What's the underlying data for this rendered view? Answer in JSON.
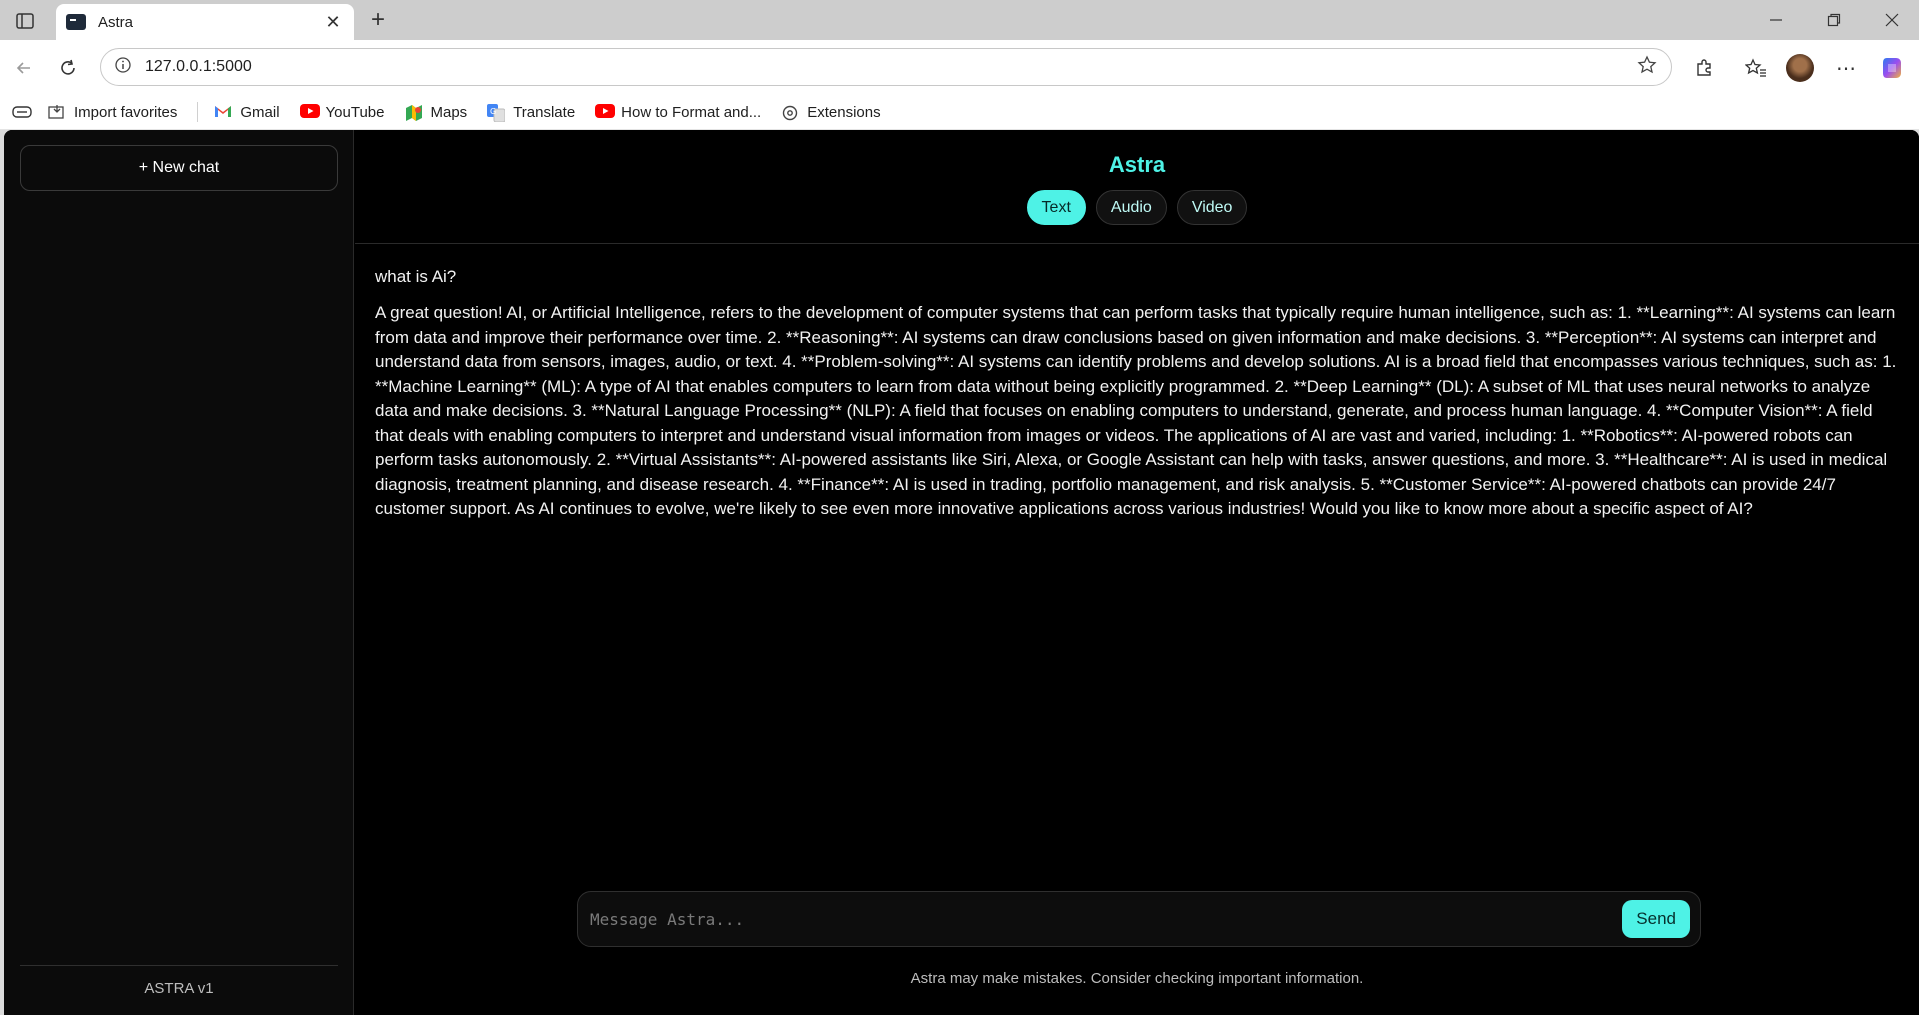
{
  "browser": {
    "tab_title": "Astra",
    "url": "127.0.0.1:5000",
    "bookmarks": [
      {
        "label": "Import favorites",
        "icon": "import-icon"
      },
      {
        "label": "Gmail",
        "icon": "gmail-icon"
      },
      {
        "label": "YouTube",
        "icon": "youtube-icon"
      },
      {
        "label": "Maps",
        "icon": "maps-icon"
      },
      {
        "label": "Translate",
        "icon": "translate-icon"
      },
      {
        "label": "How to Format and...",
        "icon": "youtube-icon"
      },
      {
        "label": "Extensions",
        "icon": "extensions-icon"
      }
    ]
  },
  "sidebar": {
    "new_chat_label": "+ New chat",
    "footer": "ASTRA v1"
  },
  "header": {
    "brand": "Astra",
    "modes": [
      "Text",
      "Audio",
      "Video"
    ],
    "active_mode": "Text"
  },
  "chat": {
    "user_message": "what is Ai?",
    "bot_message": "A great question! AI, or Artificial Intelligence, refers to the development of computer systems that can perform tasks that typically require human intelligence, such as: 1. **Learning**: AI systems can learn from data and improve their performance over time. 2. **Reasoning**: AI systems can draw conclusions based on given information and make decisions. 3. **Perception**: AI systems can interpret and understand data from sensors, images, audio, or text. 4. **Problem-solving**: AI systems can identify problems and develop solutions. AI is a broad field that encompasses various techniques, such as: 1. **Machine Learning** (ML): A type of AI that enables computers to learn from data without being explicitly programmed. 2. **Deep Learning** (DL): A subset of ML that uses neural networks to analyze data and make decisions. 3. **Natural Language Processing** (NLP): A field that focuses on enabling computers to understand, generate, and process human language. 4. **Computer Vision**: A field that deals with enabling computers to interpret and understand visual information from images or videos. The applications of AI are vast and varied, including: 1. **Robotics**: AI-powered robots can perform tasks autonomously. 2. **Virtual Assistants**: AI-powered assistants like Siri, Alexa, or Google Assistant can help with tasks, answer questions, and more. 3. **Healthcare**: AI is used in medical diagnosis, treatment planning, and disease research. 4. **Finance**: AI is used in trading, portfolio management, and risk analysis. 5. **Customer Service**: AI-powered chatbots can provide 24/7 customer support. As AI continues to evolve, we're likely to see even more innovative applications across various industries! Would you like to know more about a specific aspect of AI?"
  },
  "composer": {
    "placeholder": "Message Astra...",
    "value": "",
    "send_label": "Send"
  },
  "disclaimer": "Astra may make mistakes. Consider checking important information.",
  "colors": {
    "accent": "#4ef2e6",
    "background": "#000000",
    "sidebar": "#0b0b0b"
  }
}
